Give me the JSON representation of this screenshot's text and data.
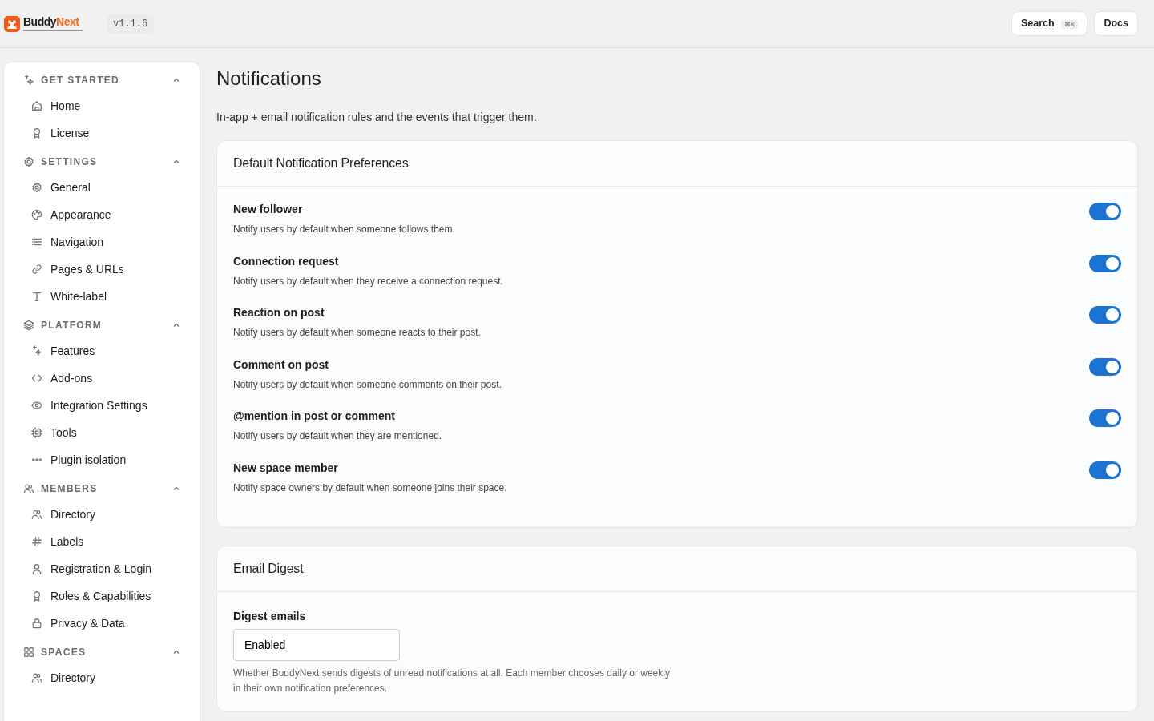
{
  "header": {
    "brand": {
      "first": "Buddy",
      "second": "Next"
    },
    "version": "v1.1.6",
    "search": {
      "label": "Search",
      "shortcut": "⌘K"
    },
    "docs": "Docs"
  },
  "sidebar": {
    "sections": [
      {
        "title": "GET STARTED",
        "expanded": true,
        "items": [
          {
            "label": "Home"
          },
          {
            "label": "License"
          }
        ]
      },
      {
        "title": "SETTINGS",
        "expanded": true,
        "items": [
          {
            "label": "General"
          },
          {
            "label": "Appearance"
          },
          {
            "label": "Navigation"
          },
          {
            "label": "Pages & URLs"
          },
          {
            "label": "White-label"
          }
        ]
      },
      {
        "title": "PLATFORM",
        "expanded": true,
        "items": [
          {
            "label": "Features"
          },
          {
            "label": "Add-ons"
          },
          {
            "label": "Integration Settings"
          },
          {
            "label": "Tools"
          },
          {
            "label": "Plugin isolation"
          }
        ]
      },
      {
        "title": "MEMBERS",
        "expanded": true,
        "items": [
          {
            "label": "Directory"
          },
          {
            "label": "Labels"
          },
          {
            "label": "Registration & Login"
          },
          {
            "label": "Roles & Capabilities"
          },
          {
            "label": "Privacy & Data"
          }
        ]
      },
      {
        "title": "SPACES",
        "expanded": true,
        "items": [
          {
            "label": "Directory"
          }
        ]
      }
    ]
  },
  "page": {
    "title": "Notifications",
    "subtitle": "In-app + email notification rules and the events that trigger them.",
    "cards": [
      {
        "title": "Default Notification Preferences",
        "kind": "toggles",
        "rows": [
          {
            "label": "New follower",
            "description": "Notify users by default when someone follows them.",
            "on": true
          },
          {
            "label": "Connection request",
            "description": "Notify users by default when they receive a connection request.",
            "on": true
          },
          {
            "label": "Reaction on post",
            "description": "Notify users by default when someone reacts to their post.",
            "on": true
          },
          {
            "label": "Comment on post",
            "description": "Notify users by default when someone comments on their post.",
            "on": true
          },
          {
            "label": "@mention in post or comment",
            "description": "Notify users by default when they are mentioned.",
            "on": true
          },
          {
            "label": "New space member",
            "description": "Notify space owners by default when someone joins their space.",
            "on": true
          }
        ]
      },
      {
        "title": "Email Digest",
        "kind": "field",
        "field": {
          "label": "Digest emails",
          "value": "Enabled",
          "help": "Whether BuddyNext sends digests of unread notifications at all. Each member chooses daily or weekly in their own notification preferences."
        }
      }
    ]
  }
}
